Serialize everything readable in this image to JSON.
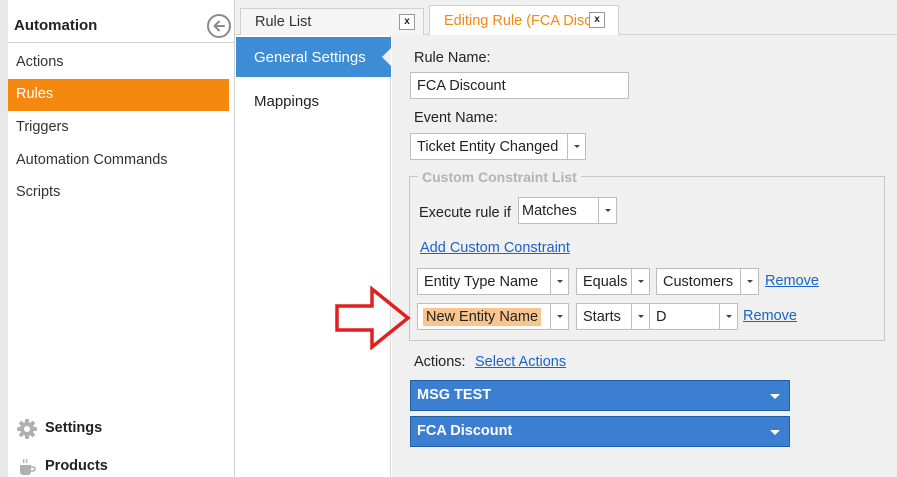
{
  "sidebar": {
    "title": "Automation",
    "items": [
      {
        "label": "Actions",
        "active": false
      },
      {
        "label": "Rules",
        "active": true
      },
      {
        "label": "Triggers",
        "active": false
      },
      {
        "label": "Automation Commands",
        "active": false
      },
      {
        "label": "Scripts",
        "active": false
      }
    ],
    "bottom": [
      {
        "label": "Settings",
        "icon": "gear-icon"
      },
      {
        "label": "Products",
        "icon": "cup-icon"
      }
    ]
  },
  "tabs": [
    {
      "label": "Rule List",
      "close": "x",
      "active": false
    },
    {
      "label": "Editing Rule (FCA Disc",
      "close": "x",
      "active": true
    }
  ],
  "nav": {
    "items": [
      {
        "label": "General Settings",
        "active": true
      },
      {
        "label": "Mappings",
        "active": false
      }
    ]
  },
  "form": {
    "rule_name_label": "Rule Name:",
    "rule_name_value": "FCA Discount",
    "event_name_label": "Event Name:",
    "event_name_value": "Ticket Entity Changed",
    "constraint_group_title": "Custom Constraint List",
    "execute_label": "Execute rule if",
    "execute_value": "Matches",
    "add_constraint_link": "Add Custom Constraint",
    "constraints": [
      {
        "field": "Entity Type Name",
        "operator": "Equals",
        "value": "Customers",
        "remove": "Remove"
      },
      {
        "field": "New Entity Name",
        "operator": "Starts",
        "value": "D",
        "remove": "Remove"
      }
    ],
    "actions_label": "Actions:",
    "select_actions_link": "Select Actions",
    "actions": [
      "MSG TEST",
      "FCA Discount"
    ]
  },
  "colors": {
    "accent_orange": "#f5880f",
    "nav_blue": "#3c8dd6",
    "action_blue": "#3c7ed0",
    "arrow_red": "#e02020",
    "highlight": "#f9c58e"
  }
}
